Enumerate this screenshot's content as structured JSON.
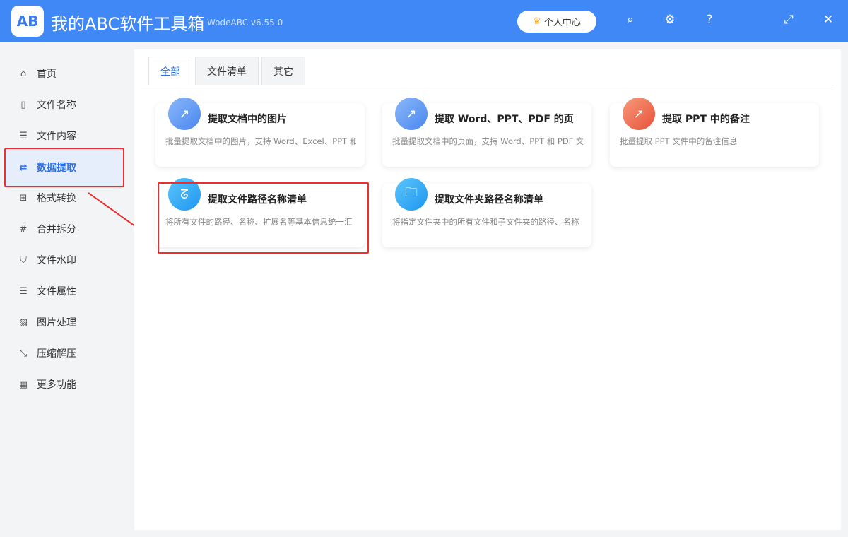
{
  "app": {
    "title": "我的ABC软件工具箱",
    "version": "WodeABC v6.55.0",
    "logo_text": "AB",
    "user_center": "个人中心"
  },
  "sidebar": {
    "items": [
      {
        "label": "首页",
        "icon": "home-icon"
      },
      {
        "label": "文件名称",
        "icon": "file-icon"
      },
      {
        "label": "文件内容",
        "icon": "list-icon"
      },
      {
        "label": "数据提取",
        "icon": "extract-icon"
      },
      {
        "label": "格式转换",
        "icon": "convert-icon"
      },
      {
        "label": "合并拆分",
        "icon": "hash-icon"
      },
      {
        "label": "文件水印",
        "icon": "shield-icon"
      },
      {
        "label": "文件属性",
        "icon": "list-icon"
      },
      {
        "label": "图片处理",
        "icon": "image-icon"
      },
      {
        "label": "压缩解压",
        "icon": "compress-icon"
      },
      {
        "label": "更多功能",
        "icon": "grid-icon"
      }
    ]
  },
  "tabs": [
    "全部",
    "文件清单",
    "其它"
  ],
  "cards": [
    {
      "title": "提取文档中的图片",
      "desc": "批量提取文档中的图片，支持 Word、Excel、PPT 和",
      "color": "#5b9af5"
    },
    {
      "title": "提取 Word、PPT、PDF 的页",
      "desc": "批量提取文档中的页面，支持 Word、PPT 和 PDF 文",
      "color": "#5b9af5"
    },
    {
      "title": "提取 PPT 中的备注",
      "desc": "批量提取 PPT 文件中的备注信息",
      "color": "#f06a4a"
    },
    {
      "title": "提取文件路径名称清单",
      "desc": "将所有文件的路径、名称、扩展名等基本信息统一汇",
      "color": "#2aa6f5"
    },
    {
      "title": "提取文件夹路径名称清单",
      "desc": "将指定文件夹中的所有文件和子文件夹的路径、名称",
      "color": "#2aa6f5"
    }
  ]
}
